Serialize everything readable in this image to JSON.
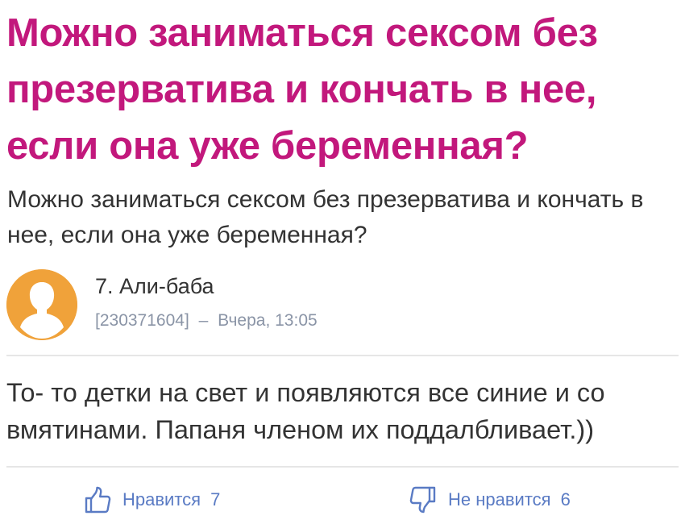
{
  "question": {
    "title": "Можно заниматься сексом без презерватива и кончать в нее, если она уже беременная?",
    "body": "Можно заниматься сексом без презерватива и кончать в нее, если она уже беременная?"
  },
  "answer": {
    "author_name": "7. Али-баба",
    "author_id": "[230371604]",
    "separator": "–",
    "timestamp": "Вчера, 13:05",
    "avatar_icon": "user-silhouette-icon",
    "text": "То- то детки на свет и появляются все синие и со вмятинами. Папаня членом их поддалбливает.))"
  },
  "actions": {
    "like_label": "Нравится",
    "like_count": "7",
    "like_icon": "thumbs-up-icon",
    "dislike_label": "Не нравится",
    "dislike_count": "6",
    "dislike_icon": "thumbs-down-icon"
  },
  "colors": {
    "title": "#c2187c",
    "text": "#333333",
    "meta": "#8a94a6",
    "action": "#5a7bc4",
    "avatar": "#f0a23a",
    "divider": "#e6e6e6"
  }
}
